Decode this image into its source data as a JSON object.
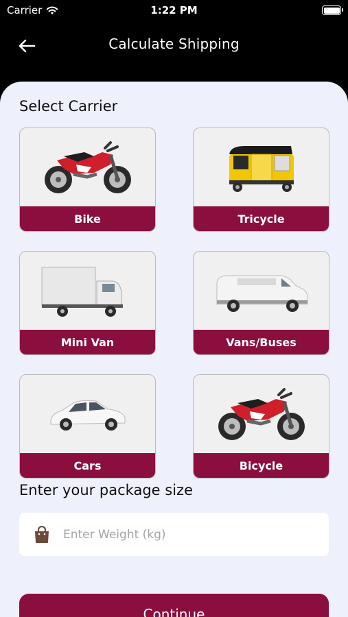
{
  "status_bar": {
    "carrier": "Carrier",
    "time": "1:22 PM"
  },
  "nav": {
    "title": "Calculate Shipping",
    "back_icon": "arrow-left-icon"
  },
  "select_carrier": {
    "title": "Select Carrier",
    "options": [
      {
        "label": "Bike",
        "icon": "motorcycle"
      },
      {
        "label": "Tricycle",
        "icon": "auto-rickshaw"
      },
      {
        "label": "Mini Van",
        "icon": "box-truck"
      },
      {
        "label": "Vans/Buses",
        "icon": "van"
      },
      {
        "label": "Cars",
        "icon": "car"
      },
      {
        "label": "Bicycle",
        "icon": "motorcycle"
      }
    ]
  },
  "package": {
    "title": "Enter your package size",
    "weight_placeholder": "Enter Weight (kg)",
    "weight_value": ""
  },
  "continue_label": "Continue",
  "colors": {
    "accent": "#8b0f3e",
    "background": "#eef0fb",
    "header": "#000000",
    "bag_icon": "#6b4a3a"
  }
}
